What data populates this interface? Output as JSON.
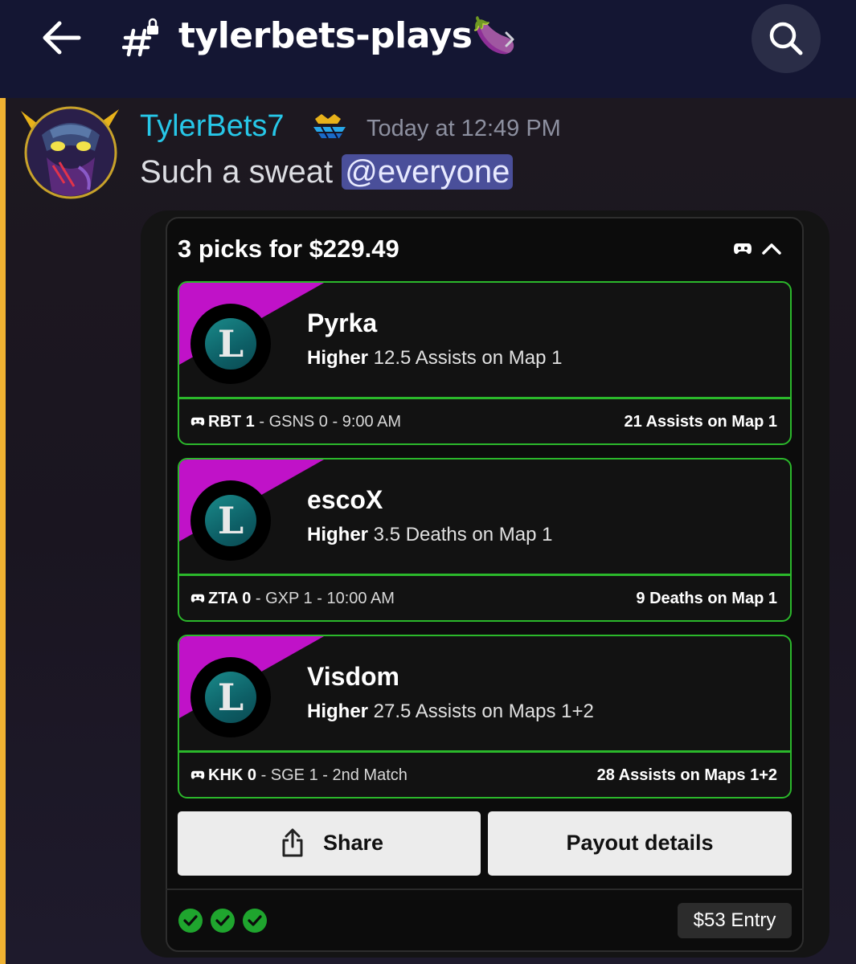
{
  "header": {
    "channel_name": "tylerbets-plays🍆"
  },
  "message": {
    "username": "TylerBets7",
    "timestamp": "Today at 12:49 PM",
    "text": "Such a sweat ",
    "mention": "@everyone"
  },
  "embed": {
    "title": "3 picks for $229.49",
    "picks": [
      {
        "player": "Pyrka",
        "direction": "Higher",
        "line": " 12.5 Assists on Map 1",
        "team1": "RBT 1",
        "match_rest": " - GSNS 0 - 9:00 AM",
        "result": "21 Assists on Map 1"
      },
      {
        "player": "escoX",
        "direction": "Higher",
        "line": " 3.5 Deaths on Map 1",
        "team1": "ZTA 0",
        "match_rest": " - GXP 1 - 10:00 AM",
        "result": "9 Deaths on Map 1"
      },
      {
        "player": "Visdom",
        "direction": "Higher",
        "line": " 27.5 Assists on Maps 1+2",
        "team1": "KHK 0",
        "match_rest": " - SGE 1 - 2nd Match",
        "result": "28 Assists on Maps 1+2"
      }
    ],
    "share_label": "Share",
    "payout_label": "Payout details",
    "entry": "$53 Entry"
  },
  "colors": {
    "header_bg": "#141633",
    "username": "#27c7e8",
    "mention_bg": "#4a4f9a",
    "pick_border": "#2bb82b",
    "pick_accent": "#c012c8",
    "check": "#1fa52e",
    "mention_bar": "#f0b232"
  },
  "icons": {
    "back": "arrow-left-icon",
    "channel": "locked-hash-icon",
    "search": "search-icon",
    "game": "gamepad-icon",
    "league": "league-of-legends-logo-icon",
    "share": "share-icon",
    "status": "check-circle-icon"
  }
}
